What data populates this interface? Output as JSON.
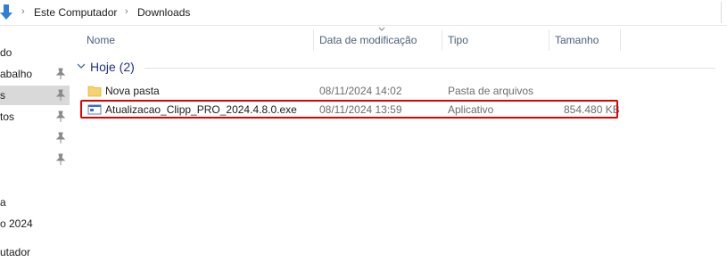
{
  "address_bar": {
    "crumbs": [
      "Este Computador",
      "Downloads"
    ]
  },
  "nav": {
    "items": [
      {
        "label": "do",
        "pinned": false
      },
      {
        "label": "abalho",
        "pinned": true
      },
      {
        "label": "s",
        "pinned": true,
        "selected": true
      },
      {
        "label": "tos",
        "pinned": true
      },
      {
        "label": "",
        "pinned": true
      },
      {
        "label": "",
        "pinned": true
      },
      {
        "label": "a",
        "pinned": false
      },
      {
        "label": "o 2024",
        "pinned": false
      },
      {
        "label": "utador",
        "pinned": false
      }
    ]
  },
  "columns": {
    "name": "Nome",
    "modified": "Data de modificação",
    "type": "Tipo",
    "size": "Tamanho"
  },
  "group": {
    "label": "Hoje (2)"
  },
  "files": [
    {
      "name": "Nova pasta",
      "modified": "08/11/2024 14:02",
      "type": "Pasta de arquivos",
      "size": "",
      "icon": "folder-icon"
    },
    {
      "name": "Atualizacao_Clipp_PRO_2024.4.8.0.exe",
      "modified": "08/11/2024 13:59",
      "type": "Aplicativo",
      "size": "854.480 KB",
      "icon": "exe-icon",
      "highlighted": true
    }
  ],
  "colors": {
    "highlight": "#e00000",
    "group_label": "#1e3287",
    "selected_nav": "#d9d9d9"
  }
}
